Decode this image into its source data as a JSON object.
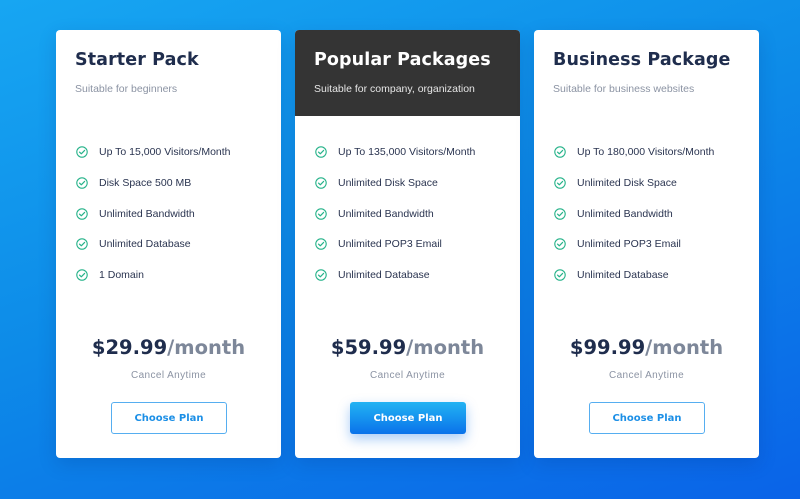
{
  "colors": {
    "background_top": "#17a6f2",
    "background_bottom": "#0a63e8",
    "featured_header": "#343434",
    "check": "#27b38a",
    "button_accent": "#1c8fe6"
  },
  "plans": [
    {
      "title": "Starter Pack",
      "subtitle": "Suitable for beginners",
      "features": [
        "Up To 15,000 Visitors/Month",
        "Disk Space 500 MB",
        "Unlimited Bandwidth",
        "Unlimited Database",
        "1 Domain"
      ],
      "price": "$29.99",
      "period": "/month",
      "note": "Cancel Anytime",
      "button": "Choose Plan",
      "icon": "check-circle-icon"
    },
    {
      "title": "Popular Packages",
      "subtitle": "Suitable for company, organization",
      "features": [
        "Up To 135,000 Visitors/Month",
        "Unlimited Disk Space",
        "Unlimited Bandwidth",
        "Unlimited POP3 Email",
        "Unlimited Database"
      ],
      "price": "$59.99",
      "period": "/month",
      "note": "Cancel Anytime",
      "button": "Choose Plan",
      "icon": "check-circle-icon"
    },
    {
      "title": "Business Package",
      "subtitle": "Suitable for business websites",
      "features": [
        "Up To 180,000 Visitors/Month",
        "Unlimited Disk Space",
        "Unlimited Bandwidth",
        "Unlimited POP3 Email",
        "Unlimited Database"
      ],
      "price": "$99.99",
      "period": "/month",
      "note": "Cancel Anytime",
      "button": "Choose Plan",
      "icon": "check-circle-icon"
    }
  ]
}
